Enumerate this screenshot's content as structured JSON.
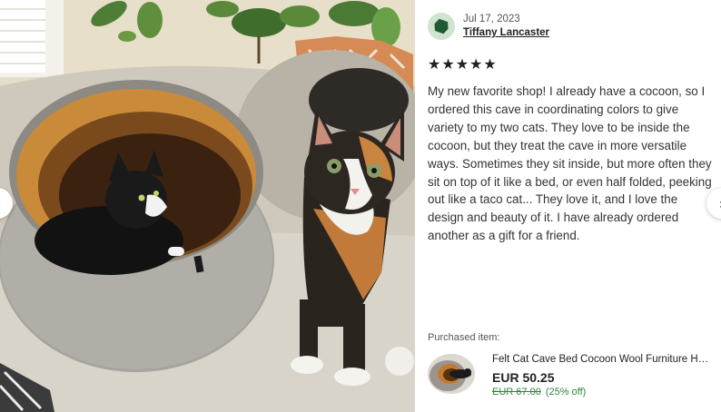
{
  "review": {
    "date": "Jul 17, 2023",
    "reviewer": "Tiffany Lancaster",
    "rating": 5,
    "stars": [
      "★",
      "★",
      "★",
      "★",
      "★"
    ],
    "text": "My new favorite shop! I already have a cocoon, so I ordered this cave in coordinating colors to give variety to my two cats. They love to be inside the cocoon, but they treat the cave in more versatile ways. Sometimes they sit inside, but more often they sit on top of it like a bed, or even half folded, peeking out like a taco cat... They love it, and I love the design and beauty of it. I have already ordered another as a gift for a friend."
  },
  "purchase": {
    "label": "Purchased item:",
    "title": "Felt Cat Cave Bed Cocoon Wool Furniture House",
    "price": "EUR 50.25",
    "original_price": "EUR 67.00",
    "discount": "(25% off)"
  },
  "navigation": {
    "prev_icon": "‹",
    "next_icon": "›"
  },
  "colors": {
    "discount_green": "#2e8540",
    "avatar_bg": "#cfe3cf",
    "avatar_icon": "#1e5a33",
    "star": "#222222"
  }
}
